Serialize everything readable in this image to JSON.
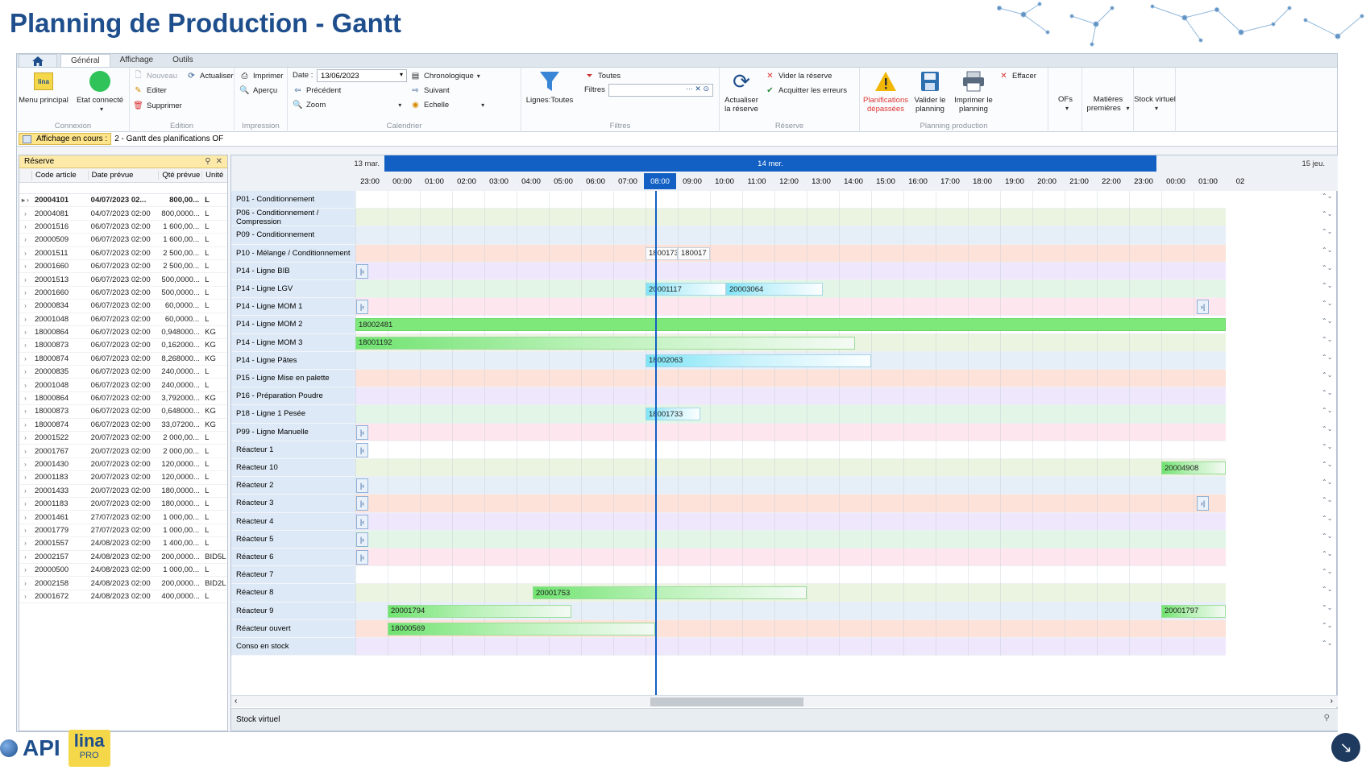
{
  "page_title": "Planning de Production - Gantt",
  "ribbon": {
    "tabs": [
      {
        "label": "Général"
      },
      {
        "label": "Affichage"
      },
      {
        "label": "Outils"
      }
    ],
    "groups": {
      "connexion": {
        "caption": "Connexion",
        "menu_principal": "Menu principal",
        "etat_connecte": "Etat connecté"
      },
      "edition": {
        "caption": "Edition",
        "nouveau": "Nouveau",
        "editer": "Editer",
        "supprimer": "Supprimer",
        "actualiser": "Actualiser"
      },
      "impression": {
        "caption": "Impression",
        "imprimer": "Imprimer",
        "apercu": "Aperçu"
      },
      "calendrier": {
        "caption": "Calendrier",
        "date_label": "Date :",
        "date_value": "13/06/2023",
        "precedent": "Précédent",
        "zoom": "Zoom",
        "chronologique": "Chronologique",
        "suivant": "Suivant",
        "echelle": "Echelle"
      },
      "filtres": {
        "caption": "Filtres",
        "lignes": "Lignes:Toutes",
        "toutes": "Toutes",
        "filtres_label": "Filtres",
        "filtres_value": ""
      },
      "reserve": {
        "caption": "Réserve",
        "actualiser_reserve": "Actualiser la réserve",
        "vider_reserve": "Vider la réserve",
        "acquitter": "Acquitter les erreurs"
      },
      "planning": {
        "caption": "Planning production",
        "planifications_depassees": "Planifications dépassées",
        "valider": "Valider le planning",
        "imprimer": "Imprimer le planning",
        "effacer": "Effacer"
      },
      "extras": {
        "ofs": "OFs",
        "matieres": "Matières premières",
        "stock": "Stock virtuel"
      }
    }
  },
  "view_bar": {
    "label": "Affichage en cours :",
    "value": "2 - Gantt des planifications OF"
  },
  "reserve_panel": {
    "title": "Réserve",
    "columns": [
      "Code article",
      "Date prévue",
      "Qté prévue",
      "Unité"
    ],
    "rows": [
      {
        "code": "20004101",
        "date": "04/07/2023 02...",
        "qty": "800,00...",
        "unit": "L",
        "selected": true
      },
      {
        "code": "20004081",
        "date": "04/07/2023 02:00",
        "qty": "800,0000...",
        "unit": "L"
      },
      {
        "code": "20001516",
        "date": "06/07/2023 02:00",
        "qty": "1 600,00...",
        "unit": "L"
      },
      {
        "code": "20000509",
        "date": "06/07/2023 02:00",
        "qty": "1 600,00...",
        "unit": "L"
      },
      {
        "code": "20001511",
        "date": "06/07/2023 02:00",
        "qty": "2 500,00...",
        "unit": "L"
      },
      {
        "code": "20001660",
        "date": "06/07/2023 02:00",
        "qty": "2 500,00...",
        "unit": "L"
      },
      {
        "code": "20001513",
        "date": "06/07/2023 02:00",
        "qty": "500,0000...",
        "unit": "L"
      },
      {
        "code": "20001660",
        "date": "06/07/2023 02:00",
        "qty": "500,0000...",
        "unit": "L"
      },
      {
        "code": "20000834",
        "date": "06/07/2023 02:00",
        "qty": "60,0000...",
        "unit": "L"
      },
      {
        "code": "20001048",
        "date": "06/07/2023 02:00",
        "qty": "60,0000...",
        "unit": "L"
      },
      {
        "code": "18000864",
        "date": "06/07/2023 02:00",
        "qty": "0,948000...",
        "unit": "KG"
      },
      {
        "code": "18000873",
        "date": "06/07/2023 02:00",
        "qty": "0,162000...",
        "unit": "KG"
      },
      {
        "code": "18000874",
        "date": "06/07/2023 02:00",
        "qty": "8,268000...",
        "unit": "KG"
      },
      {
        "code": "20000835",
        "date": "06/07/2023 02:00",
        "qty": "240,0000...",
        "unit": "L"
      },
      {
        "code": "20001048",
        "date": "06/07/2023 02:00",
        "qty": "240,0000...",
        "unit": "L"
      },
      {
        "code": "18000864",
        "date": "06/07/2023 02:00",
        "qty": "3,792000...",
        "unit": "KG"
      },
      {
        "code": "18000873",
        "date": "06/07/2023 02:00",
        "qty": "0,648000...",
        "unit": "KG"
      },
      {
        "code": "18000874",
        "date": "06/07/2023 02:00",
        "qty": "33,07200...",
        "unit": "KG"
      },
      {
        "code": "20001522",
        "date": "20/07/2023 02:00",
        "qty": "2 000,00...",
        "unit": "L"
      },
      {
        "code": "20001767",
        "date": "20/07/2023 02:00",
        "qty": "2 000,00...",
        "unit": "L"
      },
      {
        "code": "20001430",
        "date": "20/07/2023 02:00",
        "qty": "120,0000...",
        "unit": "L"
      },
      {
        "code": "20001183",
        "date": "20/07/2023 02:00",
        "qty": "120,0000...",
        "unit": "L"
      },
      {
        "code": "20001433",
        "date": "20/07/2023 02:00",
        "qty": "180,0000...",
        "unit": "L"
      },
      {
        "code": "20001183",
        "date": "20/07/2023 02:00",
        "qty": "180,0000...",
        "unit": "L"
      },
      {
        "code": "20001461",
        "date": "27/07/2023 02:00",
        "qty": "1 000,00...",
        "unit": "L"
      },
      {
        "code": "20001779",
        "date": "27/07/2023 02:00",
        "qty": "1 000,00...",
        "unit": "L"
      },
      {
        "code": "20001557",
        "date": "24/08/2023 02:00",
        "qty": "1 400,00...",
        "unit": "L"
      },
      {
        "code": "20002157",
        "date": "24/08/2023 02:00",
        "qty": "200,0000...",
        "unit": "BID5L"
      },
      {
        "code": "20000500",
        "date": "24/08/2023 02:00",
        "qty": "1 000,00...",
        "unit": "L"
      },
      {
        "code": "20002158",
        "date": "24/08/2023 02:00",
        "qty": "200,0000...",
        "unit": "BID2L"
      },
      {
        "code": "20001672",
        "date": "24/08/2023 02:00",
        "qty": "400,0000...",
        "unit": "L"
      }
    ]
  },
  "gantt": {
    "days": [
      {
        "label": "13 mar."
      },
      {
        "label": "14 mer."
      },
      {
        "label": "15 jeu."
      }
    ],
    "hours": [
      "23:00",
      "00:00",
      "01:00",
      "02:00",
      "03:00",
      "04:00",
      "05:00",
      "06:00",
      "07:00",
      "08:00",
      "09:00",
      "10:00",
      "11:00",
      "12:00",
      "13:00",
      "14:00",
      "15:00",
      "16:00",
      "17:00",
      "18:00",
      "19:00",
      "20:00",
      "21:00",
      "22:00",
      "23:00",
      "00:00",
      "01:00",
      "02"
    ],
    "current_hour": "08:00",
    "rows": [
      {
        "label": "P01 - Conditionnement"
      },
      {
        "label": "P06 - Conditionnement / Compression"
      },
      {
        "label": "P09 - Conditionnement"
      },
      {
        "label": "P10 - Mélange / Conditionnement"
      },
      {
        "label": "P14 - Ligne BIB"
      },
      {
        "label": "P14 - Ligne LGV"
      },
      {
        "label": "P14 - Ligne MOM 1"
      },
      {
        "label": "P14 - Ligne MOM 2"
      },
      {
        "label": "P14 - Ligne MOM 3"
      },
      {
        "label": "P14 - Ligne Pâtes"
      },
      {
        "label": "P15 - Ligne Mise en palette"
      },
      {
        "label": "P16 - Préparation Poudre"
      },
      {
        "label": "P18 - Ligne 1 Pesée"
      },
      {
        "label": "P99 - Ligne Manuelle"
      },
      {
        "label": "Réacteur 1"
      },
      {
        "label": "Réacteur 10"
      },
      {
        "label": "Réacteur 2"
      },
      {
        "label": "Réacteur 3"
      },
      {
        "label": "Réacteur 4"
      },
      {
        "label": "Réacteur 5"
      },
      {
        "label": "Réacteur 6"
      },
      {
        "label": "Réacteur 7"
      },
      {
        "label": "Réacteur 8"
      },
      {
        "label": "Réacteur 9"
      },
      {
        "label": "Réacteur ouvert"
      },
      {
        "label": "Conso en stock"
      }
    ],
    "bars": [
      {
        "row": 3,
        "start": "08:00",
        "hours": 1,
        "label": "1800173",
        "style": "white"
      },
      {
        "row": 3,
        "start": "09:00",
        "hours": 1,
        "label": "180017",
        "style": "white"
      },
      {
        "row": 5,
        "start": "08:00",
        "hours": 2.5,
        "label": "20001117",
        "style": "cyan"
      },
      {
        "row": 5,
        "start": "10:30",
        "hours": 3,
        "label": "20003064",
        "style": "cyan"
      },
      {
        "row": 7,
        "start": "23:00",
        "hours": 27,
        "label": "18002481",
        "style": "solidgreen"
      },
      {
        "row": 8,
        "start": "23:00",
        "hours": 15.5,
        "label": "18001192",
        "style": "green"
      },
      {
        "row": 9,
        "start": "08:00",
        "hours": 7,
        "label": "18002063",
        "style": "cyan"
      },
      {
        "row": 12,
        "start": "08:00",
        "hours": 1.7,
        "label": "18001733",
        "style": "cyan"
      },
      {
        "row": 15,
        "start": "00:00+",
        "hours": 2,
        "label": "20004908",
        "style": "green"
      },
      {
        "row": 22,
        "start": "04:30",
        "hours": 8.5,
        "label": "20001753",
        "style": "green"
      },
      {
        "row": 23,
        "start": "00:00",
        "hours": 5.7,
        "label": "20001794",
        "style": "green"
      },
      {
        "row": 23,
        "start": "00:00+",
        "hours": 2,
        "label": "20001797",
        "style": "green"
      },
      {
        "row": 24,
        "start": "00:00",
        "hours": 8.3,
        "label": "18000569",
        "style": "green"
      }
    ],
    "nav_left_rows": [
      4,
      6,
      13,
      14,
      16,
      17,
      18,
      19,
      20
    ],
    "nav_right_rows": [
      6,
      17
    ],
    "footer": "Stock virtuel"
  },
  "colors": {
    "title": "#1e4e8c",
    "now": "#1260c4",
    "row_palette": [
      "#ffffff",
      "#eaf4e0",
      "#e6eff8",
      "#fde2da",
      "#efe7fb",
      "#e2f5e6",
      "#fde6ee"
    ]
  }
}
